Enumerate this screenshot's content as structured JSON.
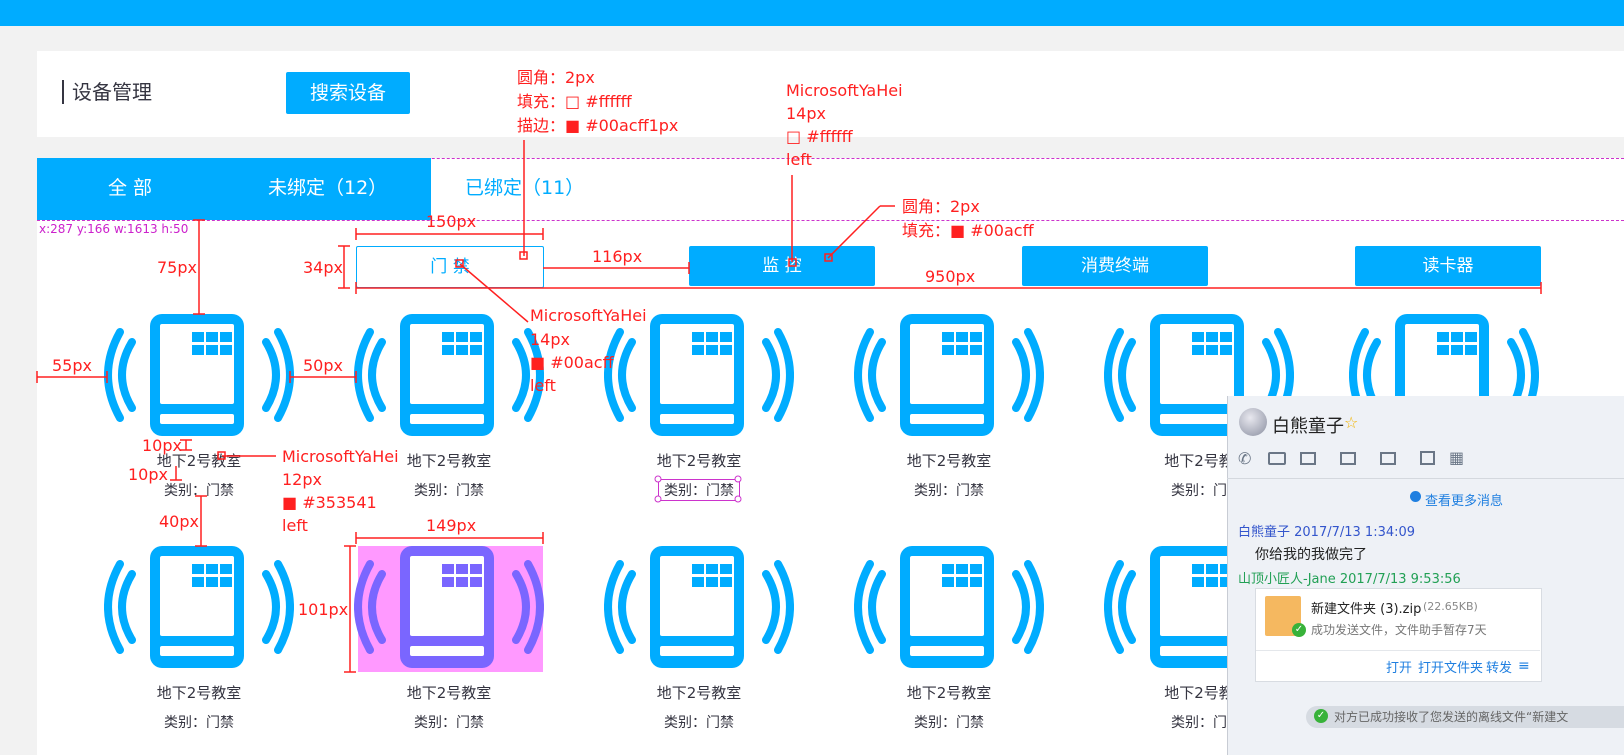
{
  "header": {
    "title": "设备管理",
    "search_button": "搜索设备"
  },
  "tabs": [
    {
      "label": "全 部"
    },
    {
      "label": "未绑定（12）"
    },
    {
      "label": "已绑定（11）"
    }
  ],
  "categories": [
    {
      "label": "门 禁"
    },
    {
      "label": "监 控"
    },
    {
      "label": "消费终端"
    },
    {
      "label": "读卡器"
    }
  ],
  "devices": {
    "name": "地下2号教室",
    "type": "类别：门禁",
    "row1_names": [
      "地下2号教室",
      "地下2号教室",
      "地下2号教室",
      "地下2号教室",
      "地下2号教"
    ],
    "row1_types": [
      "类别：门禁",
      "类别：门禁",
      "类别：门禁",
      "类别：门禁",
      "类别：门"
    ],
    "row2_names": [
      "地下2号教室",
      "地下2号教室",
      "地下2号教室",
      "地下2号教室",
      "地下2号教"
    ],
    "row2_types": [
      "类别：门禁",
      "类别：门禁",
      "类别：门禁",
      "类别：门禁",
      "类别：门"
    ]
  },
  "annotations": {
    "btn_spec": [
      "圆角：2px",
      "填充：□ #ffffff",
      "描边：■ #00acff1px"
    ],
    "font_spec_white": [
      "MicrosoftYaHei",
      "14px",
      "□ #ffffff",
      "left"
    ],
    "fill_spec": [
      "圆角：2px",
      "填充：■ #00acff"
    ],
    "font_spec_blue": [
      "MicrosoftYaHei",
      "14px",
      "■ #00acff",
      "left"
    ],
    "font_spec_dark": [
      "MicrosoftYaHei",
      "12px",
      "■ #353541",
      "left"
    ],
    "bbox_label": "x:287 y:166 w:1613 h:50",
    "dims": {
      "d150": "150px",
      "d34": "34px",
      "d116": "116px",
      "d950": "950px",
      "d75": "75px",
      "d55": "55px",
      "d50": "50px",
      "d10a": "10px",
      "d10b": "10px",
      "d40": "40px",
      "d149": "149px",
      "d101": "101px"
    }
  },
  "chat": {
    "name": "白熊童子",
    "more": "查看更多消息",
    "sender1": "白熊童子 2017/7/13 1:34:09",
    "message1": "你给我的我做完了",
    "sender2": "山顶小匠人-Jane 2017/7/13 9:53:56",
    "file_name": "新建文件夹 (3).zip",
    "file_size": "(22.65KB)",
    "file_status": "成功发送文件，文件助手暂存7天",
    "actions": [
      "打开",
      "打开文件夹",
      "转发"
    ],
    "notice": "对方已成功接收了您发送的离线文件“新建文"
  },
  "colors": {
    "accent": "#00acff",
    "annotation": "#ff0000",
    "highlight": "#ff99ff",
    "text": "#353541"
  }
}
